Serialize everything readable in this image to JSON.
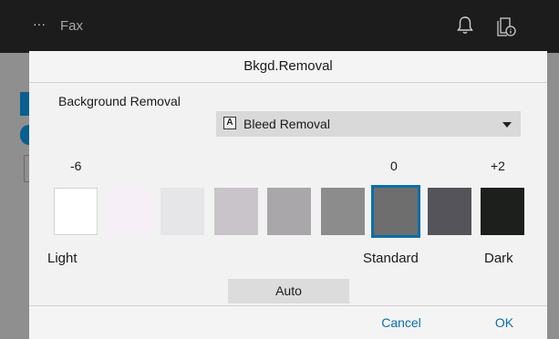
{
  "app": {
    "title": "Fax",
    "menu_glyph": "···",
    "icons": [
      "menu-icon",
      "bell-icon",
      "job-status-icon"
    ]
  },
  "dialog": {
    "title": "Bkgd.Removal",
    "section_label": "Background Removal",
    "select": {
      "icon_letter": "A",
      "value": "Bleed Removal"
    },
    "scale_numbers": {
      "min": "-6",
      "mid": "0",
      "max": "+2"
    },
    "levels": [
      {
        "value": -6,
        "color": "#ffffff",
        "selected": false
      },
      {
        "value": -5,
        "color": "#f7eff7",
        "selected": false
      },
      {
        "value": -4,
        "color": "#e6e5e8",
        "selected": false
      },
      {
        "value": -3,
        "color": "#c8c4ca",
        "selected": false
      },
      {
        "value": -2,
        "color": "#aaa7aa",
        "selected": false
      },
      {
        "value": -1,
        "color": "#8c8c8c",
        "selected": false
      },
      {
        "value": 0,
        "color": "#6e6e6e",
        "selected": true
      },
      {
        "value": 1,
        "color": "#55545a",
        "selected": false
      },
      {
        "value": 2,
        "color": "#1c1f1c",
        "selected": false
      }
    ],
    "scale_labels": {
      "left": "Light",
      "center": "Standard",
      "right": "Dark"
    },
    "auto_label": "Auto",
    "cancel_label": "Cancel",
    "ok_label": "OK"
  },
  "colors": {
    "accent": "#0a6ea8",
    "topbar": "#1c1c1c"
  }
}
